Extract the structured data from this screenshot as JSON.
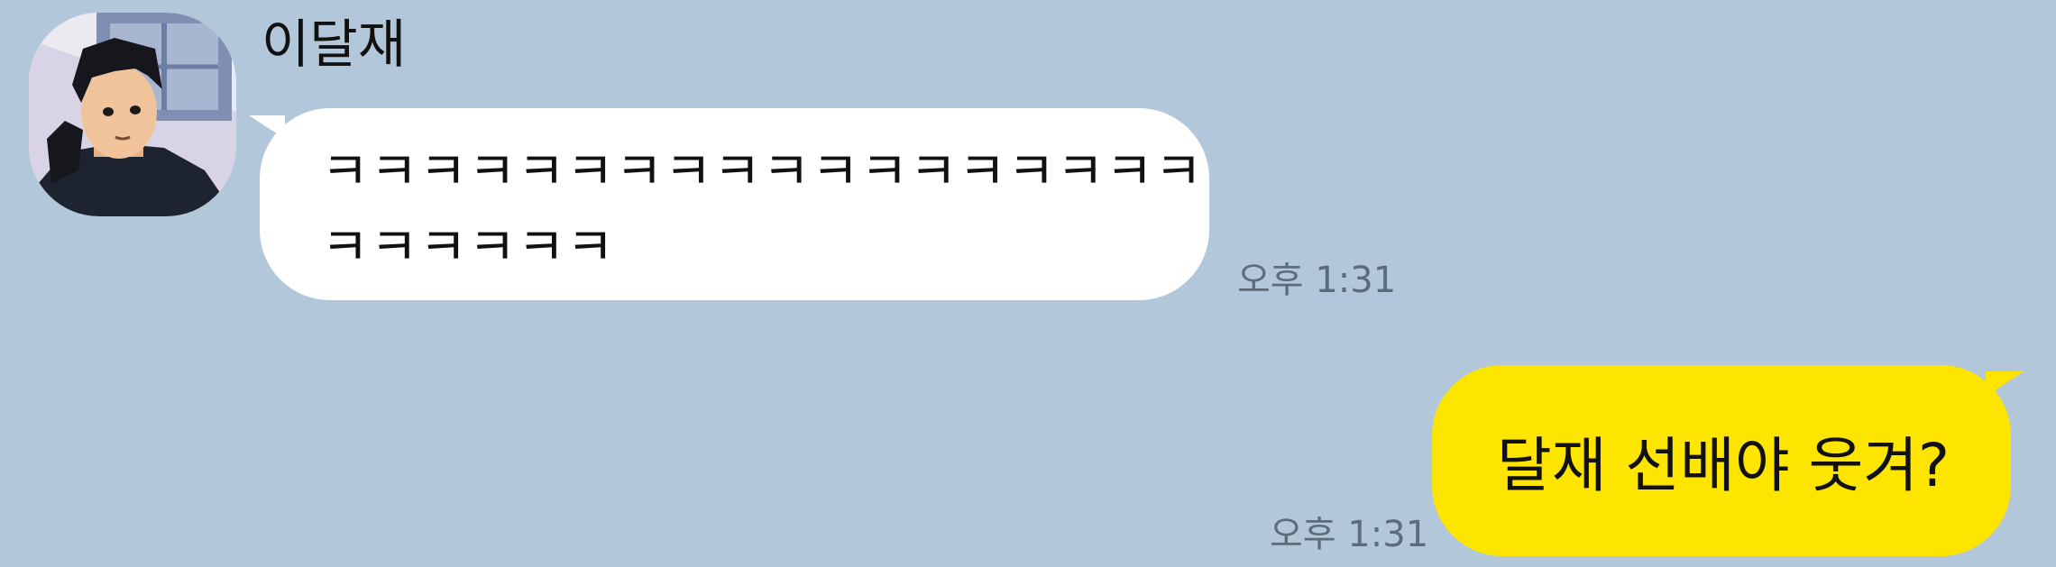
{
  "chat": {
    "incoming": {
      "sender_name": "이달재",
      "message": "ㅋㅋㅋㅋㅋㅋㅋㅋㅋㅋㅋㅋㅋㅋㅋㅋㅋㅋㅋㅋㅋㅋㅋㅋ",
      "time": "오후 1:31",
      "bubble_color": "#ffffff"
    },
    "outgoing": {
      "message": "달재 선배야 웃겨?",
      "time": "오후 1:31",
      "bubble_color": "#fee500"
    },
    "background_color": "#b2c7da",
    "avatar_icon": "profile-avatar-icon"
  }
}
